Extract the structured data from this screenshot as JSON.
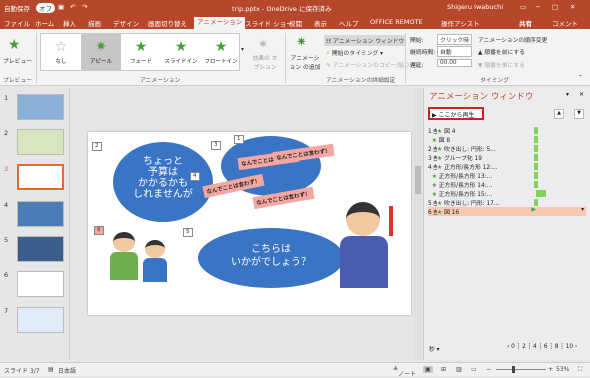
{
  "titlebar": {
    "autosave": "自動保存",
    "autosave_state": "オフ",
    "doc_title": "trip.pptx - OneDrive に保存済み",
    "user": "Shigeru Iwabuchi"
  },
  "tabs": [
    "ファイル",
    "ホーム",
    "挿入",
    "描画",
    "デザイン",
    "画面切り替え",
    "アニメーション",
    "スライド ショー",
    "校閲",
    "表示",
    "ヘルプ",
    "OFFICE REMOTE",
    "操作アシスト"
  ],
  "active_tab": "アニメーション",
  "share_label": "共有",
  "comment_label": "コメント",
  "ribbon": {
    "preview": "プレビュー",
    "preview_group": "プレビュー",
    "gallery": [
      "なし",
      "アピール",
      "フェード",
      "スライドイン",
      "フロートイン"
    ],
    "effect_options": "効果の オプション",
    "animation_group": "アニメーション",
    "add_animation": "アニメーション の追加",
    "anim_window": "アニメーション ウィンドウ",
    "trigger": "開始のタイミング",
    "anim_painter": "アニメーションのコピー/貼り付け",
    "adv_group": "アニメーションの詳細設定",
    "start_label": "開始:",
    "start_value": "クリック時",
    "duration_label": "継続時間:",
    "duration_value": "自動",
    "delay_label": "遅延:",
    "delay_value": "00.00",
    "reorder": "アニメーションの順序変更",
    "move_earlier": "順番を前にする",
    "move_later": "順番を後にする",
    "timing_group": "タイミング"
  },
  "thumbnails": [
    {
      "num": "1"
    },
    {
      "num": "2"
    },
    {
      "num": "3"
    },
    {
      "num": "4"
    },
    {
      "num": "5"
    },
    {
      "num": "6"
    },
    {
      "num": "7"
    }
  ],
  "slide": {
    "bubble1": "ちょっと\n予算は\nかかるかも\nしれませんが",
    "bubble2": "こちらは\nいかがでしょう？",
    "pink_text": "なんでことは言わず！",
    "tags": [
      "2",
      "3",
      "1",
      "4",
      "5",
      "6"
    ]
  },
  "anim_pane": {
    "title": "アニメーション ウィンドウ",
    "play_from": "ここから再生",
    "items": [
      {
        "num": "1",
        "name": "図 4"
      },
      {
        "num": "",
        "name": "図 8"
      },
      {
        "num": "2",
        "name": "吹き出し: 円形: 5..."
      },
      {
        "num": "3",
        "name": "グループ化 19"
      },
      {
        "num": "4",
        "name": "正方形/長方形 12:..."
      },
      {
        "num": "",
        "name": "正方形/長方形 13:..."
      },
      {
        "num": "",
        "name": "正方形/長方形 14:..."
      },
      {
        "num": "",
        "name": "正方形/長方形 15:..."
      },
      {
        "num": "5",
        "name": "吹き出し: 円形: 17..."
      },
      {
        "num": "6",
        "name": "図 16"
      }
    ],
    "seconds_label": "秒",
    "timeline": [
      "0",
      "2",
      "4",
      "6",
      "8",
      "10"
    ]
  },
  "statusbar": {
    "slide_info": "スライド 3/7",
    "language": "日本語",
    "notes": "ノート",
    "zoom": "53%"
  },
  "colors": {
    "accent": "#b7472a",
    "bubble": "#3a74c4",
    "pink": "#f4a7a0",
    "green": "#7fd35a"
  }
}
